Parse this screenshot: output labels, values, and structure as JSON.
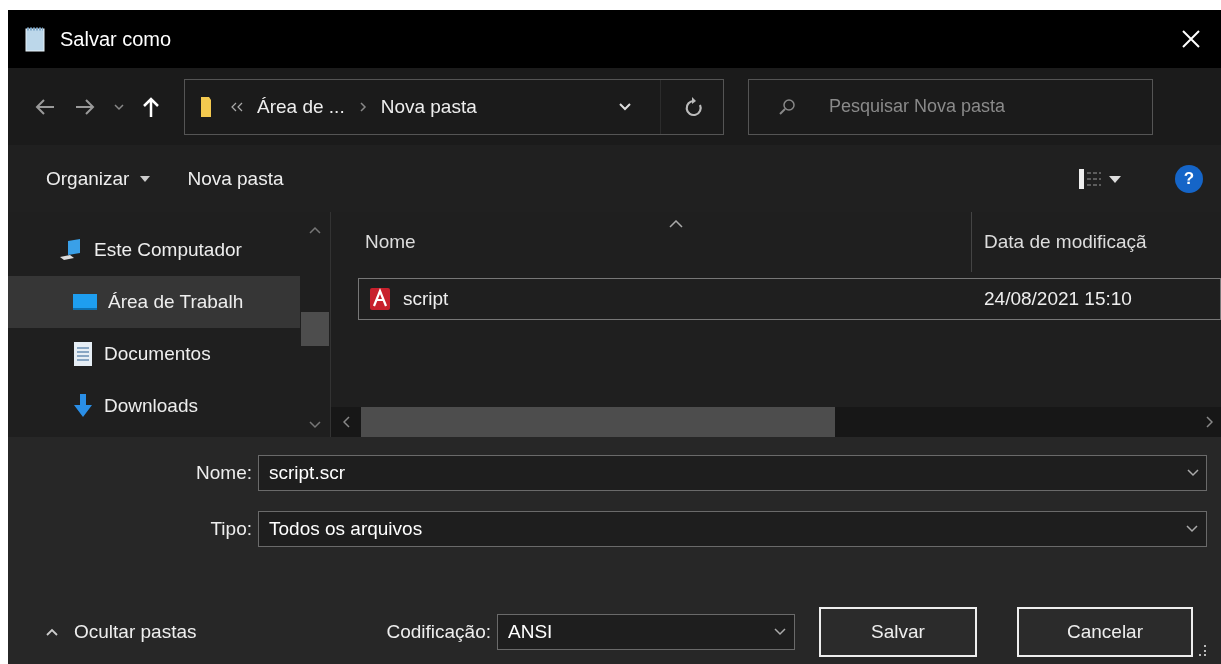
{
  "window": {
    "title": "Salvar como"
  },
  "address": {
    "path": [
      "Área de ...",
      "Nova pasta"
    ]
  },
  "search": {
    "placeholder": "Pesquisar Nova pasta"
  },
  "toolbar": {
    "organize": "Organizar",
    "new_folder": "Nova pasta",
    "help": "?"
  },
  "sidebar": {
    "items": [
      {
        "label": "Este Computador",
        "kind": "computer",
        "selected": false
      },
      {
        "label": "Área de Trabalh",
        "kind": "desktop",
        "selected": true
      },
      {
        "label": "Documentos",
        "kind": "documents",
        "selected": false
      },
      {
        "label": "Downloads",
        "kind": "downloads",
        "selected": false
      }
    ]
  },
  "table": {
    "columns": [
      "Nome",
      "Data de modificaçã"
    ],
    "rows": [
      {
        "name": "script",
        "date": "24/08/2021 15:10",
        "focused": true
      }
    ]
  },
  "form": {
    "file_name": {
      "label": "Nome:",
      "value": "script.scr"
    },
    "file_type": {
      "label": "Tipo:",
      "value": "Todos os arquivos"
    },
    "encoding": {
      "label": "Codificação:",
      "value": "ANSI"
    }
  },
  "hide_folders": "Ocultar pastas",
  "buttons": [
    "Salvar",
    "Cancelar"
  ]
}
